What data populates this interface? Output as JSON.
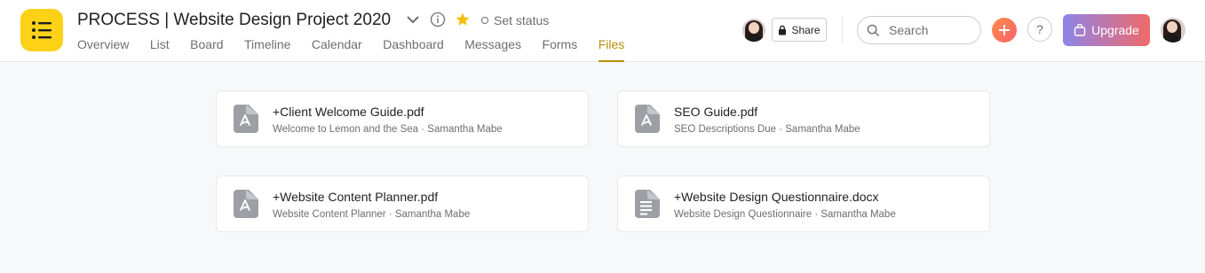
{
  "header": {
    "title": "PROCESS | Website Design Project 2020",
    "set_status": "Set status",
    "tabs": [
      "Overview",
      "List",
      "Board",
      "Timeline",
      "Calendar",
      "Dashboard",
      "Messages",
      "Forms",
      "Files"
    ],
    "active_tab": "Files",
    "share_label": "Share",
    "search_placeholder": "Search",
    "help_label": "?",
    "upgrade_label": "Upgrade",
    "colors": {
      "app_icon": "#fcd116",
      "active_tab": "#b78f05",
      "star": "#f4c00a"
    }
  },
  "files": [
    {
      "name": "+Client Welcome Guide.pdf",
      "meta": "Welcome to Lemon and the Sea · Samantha Mabe",
      "icon": "pdf-icon"
    },
    {
      "name": "SEO Guide.pdf",
      "meta": "SEO Descriptions Due · Samantha Mabe",
      "icon": "pdf-icon"
    },
    {
      "name": "+Website Content Planner.pdf",
      "meta": "Website Content Planner · Samantha Mabe",
      "icon": "pdf-icon"
    },
    {
      "name": "+Website Design Questionnaire.docx",
      "meta": "Website Design Questionnaire · Samantha Mabe",
      "icon": "document-icon"
    }
  ]
}
